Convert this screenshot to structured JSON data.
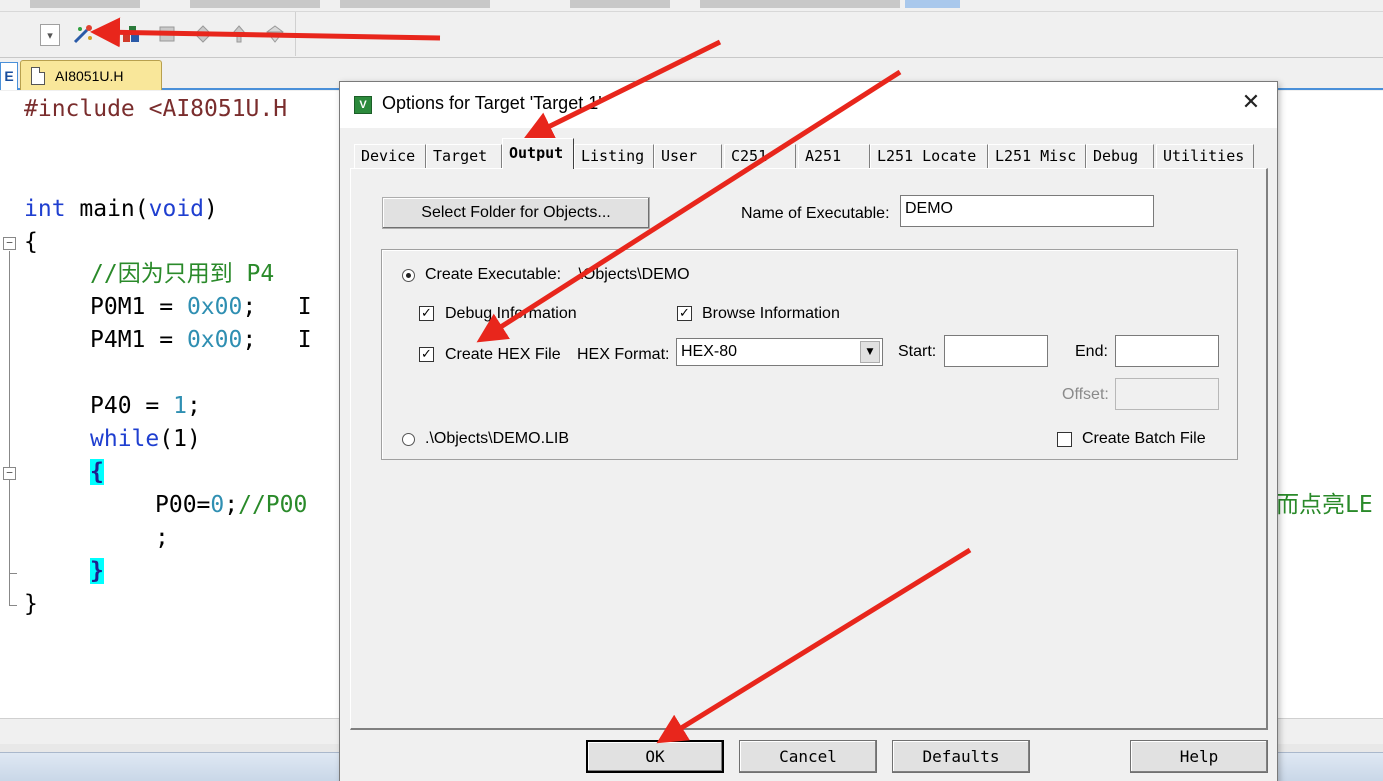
{
  "editor": {
    "tab_edge_label": "E",
    "file_tab": "AI8051U.H",
    "lines": [
      {
        "code_include_kw": "#include ",
        "code_include_file": "<AI8051U.H"
      },
      {
        "code_int": "int",
        "code_main": " main(",
        "code_void": "void",
        "code_close": ")"
      },
      {
        "code": "{"
      },
      {
        "comment": "//因为只用到 P4"
      },
      {
        "reg": "P0M1 = ",
        "val": "0x00",
        "rest": ";   I"
      },
      {
        "reg": "P4M1 = ",
        "val": "0x00",
        "rest": ";   I"
      },
      {
        "reg": "P40 = ",
        "val": "1",
        "rest": ";"
      },
      {
        "kw": "while",
        "rest": "(1)"
      },
      {
        "brace": "{"
      },
      {
        "reg": "P00=",
        "val": "0",
        "rest": ";",
        "comment": "//P00"
      },
      {
        "code": ";"
      },
      {
        "brace": "}"
      },
      {
        "code": "}"
      }
    ],
    "right_comment": "而点亮LE"
  },
  "dialog": {
    "title": "Options for Target 'Target 1'",
    "close_glyph": "✕",
    "tabs": [
      "Device",
      "Target",
      "Output",
      "Listing",
      "User",
      "C251",
      "A251",
      "L251 Locate",
      "L251 Misc",
      "Debug",
      "Utilities"
    ],
    "active_tab": "Output",
    "select_folder_button": "Select Folder for Objects...",
    "name_of_executable_label": "Name of Executable:",
    "name_of_executable_value": "DEMO",
    "create_executable_label": "Create Executable:",
    "create_executable_path": ".\\Objects\\DEMO",
    "debug_information_label": "Debug Information",
    "browse_information_label": "Browse Information",
    "create_hex_label": "Create HEX File",
    "hex_format_label": "HEX Format:",
    "hex_format_value": "HEX-80",
    "start_label": "Start:",
    "end_label": "End:",
    "offset_label": "Offset:",
    "create_library_label": ".\\Objects\\DEMO.LIB",
    "create_batch_label": "Create Batch File",
    "buttons": {
      "ok": "OK",
      "cancel": "Cancel",
      "defaults": "Defaults",
      "help": "Help"
    },
    "checks": {
      "debug_information": true,
      "browse_information": true,
      "create_hex": true,
      "create_batch": false
    },
    "radio_selected": "create_executable"
  },
  "annotation_colors": {
    "arrow": "#e8261c"
  }
}
